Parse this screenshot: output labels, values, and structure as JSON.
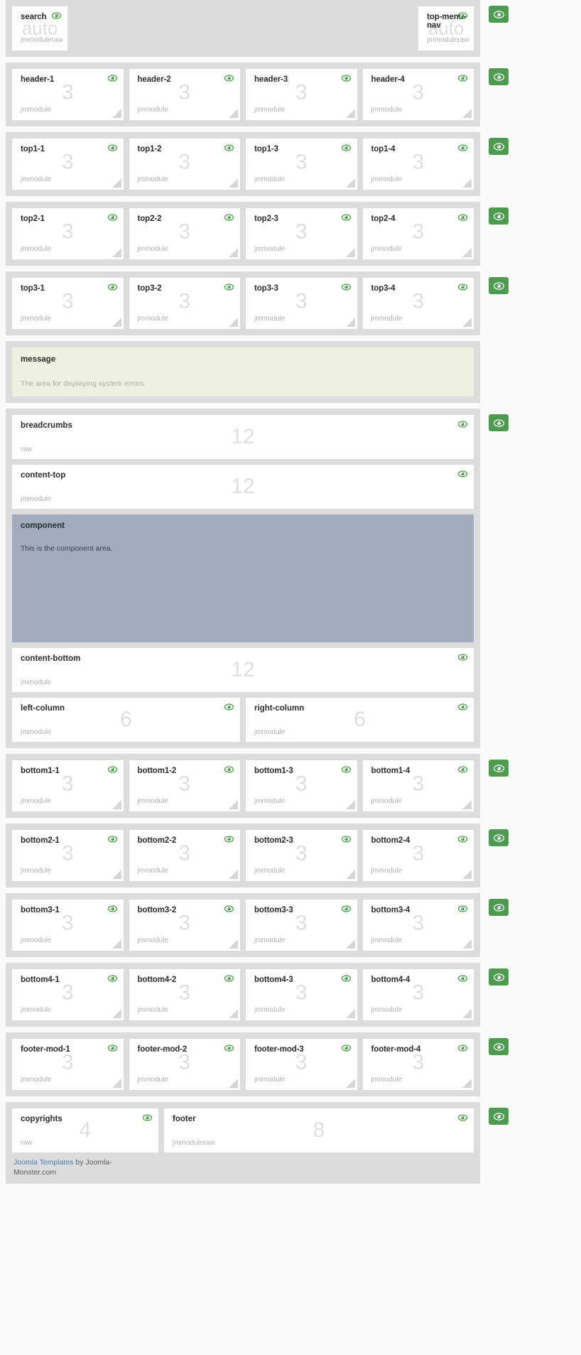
{
  "icons": {
    "eye": "eye-icon",
    "toggle": "visibility-toggle-icon",
    "grip": "resize-grip-icon"
  },
  "colors": {
    "band": "#dcdcdc",
    "module": "#ffffff",
    "toggle_green": "#4e9a51",
    "eye_green": "#3f9a3f",
    "message_bg": "#eef0e2",
    "component_bg": "#a3acbe",
    "number_grey": "#dedede",
    "link_blue": "#4a7fb5"
  },
  "rows": [
    {
      "name": "search-row",
      "toggle": true,
      "layout": "auto",
      "modules": [
        {
          "title": "search",
          "num": "auto",
          "sub": "jmmoduleraw",
          "eye": true,
          "grip": false
        },
        {
          "title": "top-menu-nav",
          "num": "auto",
          "sub": "jmmoduleraw",
          "eye": true,
          "grip": false
        }
      ]
    },
    {
      "name": "header-row",
      "toggle": true,
      "layout": "four",
      "modules": [
        {
          "title": "header-1",
          "num": "3",
          "sub": "jmmodule",
          "eye": true,
          "grip": true
        },
        {
          "title": "header-2",
          "num": "3",
          "sub": "jmmodule",
          "eye": true,
          "grip": true
        },
        {
          "title": "header-3",
          "num": "3",
          "sub": "jmmodule",
          "eye": true,
          "grip": true
        },
        {
          "title": "header-4",
          "num": "3",
          "sub": "jmmodule",
          "eye": true,
          "grip": true
        }
      ]
    },
    {
      "name": "top1-row",
      "toggle": true,
      "layout": "four",
      "modules": [
        {
          "title": "top1-1",
          "num": "3",
          "sub": "jmmodule",
          "eye": true,
          "grip": true
        },
        {
          "title": "top1-2",
          "num": "3",
          "sub": "jmmodule",
          "eye": true,
          "grip": true
        },
        {
          "title": "top1-3",
          "num": "3",
          "sub": "jmmodule",
          "eye": true,
          "grip": true
        },
        {
          "title": "top1-4",
          "num": "3",
          "sub": "jmmodule",
          "eye": true,
          "grip": true
        }
      ]
    },
    {
      "name": "top2-row",
      "toggle": true,
      "layout": "four",
      "modules": [
        {
          "title": "top2-1",
          "num": "3",
          "sub": "jmmodule",
          "eye": true,
          "grip": true
        },
        {
          "title": "top2-2",
          "num": "3",
          "sub": "jmmodule",
          "eye": true,
          "grip": true
        },
        {
          "title": "top2-3",
          "num": "3",
          "sub": "jmmodule",
          "eye": true,
          "grip": true
        },
        {
          "title": "top2-4",
          "num": "3",
          "sub": "jmmodule",
          "eye": true,
          "grip": true
        }
      ]
    },
    {
      "name": "top3-row",
      "toggle": true,
      "layout": "four",
      "modules": [
        {
          "title": "top3-1",
          "num": "3",
          "sub": "jmmodule",
          "eye": true,
          "grip": true
        },
        {
          "title": "top3-2",
          "num": "3",
          "sub": "jmmodule",
          "eye": true,
          "grip": true
        },
        {
          "title": "top3-3",
          "num": "3",
          "sub": "jmmodule",
          "eye": true,
          "grip": true
        },
        {
          "title": "top3-4",
          "num": "3",
          "sub": "jmmodule",
          "eye": true,
          "grip": true
        }
      ]
    },
    {
      "name": "bottom1-row",
      "toggle": true,
      "layout": "four",
      "modules": [
        {
          "title": "bottom1-1",
          "num": "3",
          "sub": "jmmodule",
          "eye": true,
          "grip": true
        },
        {
          "title": "bottom1-2",
          "num": "3",
          "sub": "jmmodule",
          "eye": true,
          "grip": true
        },
        {
          "title": "bottom1-3",
          "num": "3",
          "sub": "jmmodule",
          "eye": true,
          "grip": true
        },
        {
          "title": "bottom1-4",
          "num": "3",
          "sub": "jmmodule",
          "eye": true,
          "grip": true
        }
      ]
    },
    {
      "name": "bottom2-row",
      "toggle": true,
      "layout": "four",
      "modules": [
        {
          "title": "bottom2-1",
          "num": "3",
          "sub": "jmmodule",
          "eye": true,
          "grip": true
        },
        {
          "title": "bottom2-2",
          "num": "3",
          "sub": "jmmodule",
          "eye": true,
          "grip": true
        },
        {
          "title": "bottom2-3",
          "num": "3",
          "sub": "jmmodule",
          "eye": true,
          "grip": true
        },
        {
          "title": "bottom2-4",
          "num": "3",
          "sub": "jmmodule",
          "eye": true,
          "grip": true
        }
      ]
    },
    {
      "name": "bottom3-row",
      "toggle": true,
      "layout": "four",
      "modules": [
        {
          "title": "bottom3-1",
          "num": "3",
          "sub": "jmmodule",
          "eye": true,
          "grip": true
        },
        {
          "title": "bottom3-2",
          "num": "3",
          "sub": "jmmodule",
          "eye": true,
          "grip": true
        },
        {
          "title": "bottom3-3",
          "num": "3",
          "sub": "jmmodule",
          "eye": true,
          "grip": true
        },
        {
          "title": "bottom3-4",
          "num": "3",
          "sub": "jmmodule",
          "eye": true,
          "grip": true
        }
      ]
    },
    {
      "name": "bottom4-row",
      "toggle": true,
      "layout": "four",
      "modules": [
        {
          "title": "bottom4-1",
          "num": "3",
          "sub": "jmmodule",
          "eye": true,
          "grip": true
        },
        {
          "title": "bottom4-2",
          "num": "3",
          "sub": "jmmodule",
          "eye": true,
          "grip": true
        },
        {
          "title": "bottom4-3",
          "num": "3",
          "sub": "jmmodule",
          "eye": true,
          "grip": true
        },
        {
          "title": "bottom4-4",
          "num": "3",
          "sub": "jmmodule",
          "eye": true,
          "grip": true
        }
      ]
    },
    {
      "name": "footer-mod-row",
      "toggle": true,
      "layout": "four",
      "modules": [
        {
          "title": "footer-mod-1",
          "num": "3",
          "sub": "jmmodule",
          "eye": true,
          "grip": true
        },
        {
          "title": "footer-mod-2",
          "num": "3",
          "sub": "jmmodule",
          "eye": true,
          "grip": true
        },
        {
          "title": "footer-mod-3",
          "num": "3",
          "sub": "jmmodule",
          "eye": true,
          "grip": true
        },
        {
          "title": "footer-mod-4",
          "num": "3",
          "sub": "jmmodule",
          "eye": true,
          "grip": true
        }
      ]
    }
  ],
  "message": {
    "title": "message",
    "text": "The area for displaying system errors."
  },
  "content": {
    "breadcrumbs": {
      "title": "breadcrumbs",
      "num": "12",
      "sub": "raw",
      "eye": true
    },
    "content_top": {
      "title": "content-top",
      "num": "12",
      "sub": "jmmodule",
      "eye": true
    },
    "component": {
      "title": "component",
      "text": "This is the component area."
    },
    "content_bottom": {
      "title": "content-bottom",
      "num": "12",
      "sub": "jmmodule",
      "eye": true
    },
    "left_column": {
      "title": "left-column",
      "num": "6",
      "sub": "jmmodule",
      "eye": true
    },
    "right_column": {
      "title": "right-column",
      "num": "6",
      "sub": "jmmodule",
      "eye": true
    }
  },
  "footer": {
    "copyrights": {
      "title": "copyrights",
      "num": "4",
      "sub": "raw",
      "eye": true
    },
    "footer_mod": {
      "title": "footer",
      "num": "8",
      "sub": "jmmoduleraw",
      "eye": true
    },
    "credit_link": "Joomla Templates",
    "credit_text": " by Joomla-Monster.com"
  }
}
